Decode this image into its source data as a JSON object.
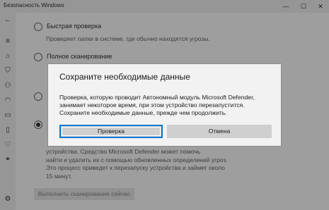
{
  "window": {
    "title": "Безопасность Windows",
    "controls": {
      "minimize": "—",
      "maximize": "☐",
      "close": "✕"
    }
  },
  "nav": {
    "items": [
      {
        "name": "back-icon",
        "glyph": "←"
      },
      {
        "name": "menu-icon",
        "glyph": "≡"
      },
      {
        "name": "home-icon",
        "glyph": "⌂"
      },
      {
        "name": "shield-icon",
        "glyph": "⛉"
      },
      {
        "name": "account-icon",
        "glyph": "⚇"
      },
      {
        "name": "network-icon",
        "glyph": "◠"
      },
      {
        "name": "app-browser-icon",
        "glyph": "▭"
      },
      {
        "name": "device-security-icon",
        "glyph": "▯"
      },
      {
        "name": "performance-icon",
        "glyph": "♡"
      },
      {
        "name": "family-icon",
        "glyph": "⚭"
      },
      {
        "name": "settings-icon",
        "glyph": "⚙"
      }
    ]
  },
  "scan_options": {
    "quick": {
      "label": "Быстрая проверка",
      "description": "Проверяет папки в системе, где обычно находятся угрозы."
    },
    "full": {
      "label": "Полное сканирование"
    },
    "offline_description": [
      "устройства. Средство Microsoft Defender может помочь",
      "найти и удалить их с помощью обновленных определений угроз.",
      "Это процесс приведет к перезапуску устройства и займет около",
      "15 минут."
    ],
    "run_button": "Выполнить сканирование сейчас"
  },
  "dialog": {
    "title": "Сохраните необходимые данные",
    "body_lines": [
      "Проверка, которую проводит Автономный модуль Microsoft Defender,",
      "занимает некоторое время, при этом устройство перезапустится.",
      "Сохраните необходимые данные, прежде чем продолжить."
    ],
    "confirm_label": "Проверка",
    "cancel_label": "Отмена"
  }
}
